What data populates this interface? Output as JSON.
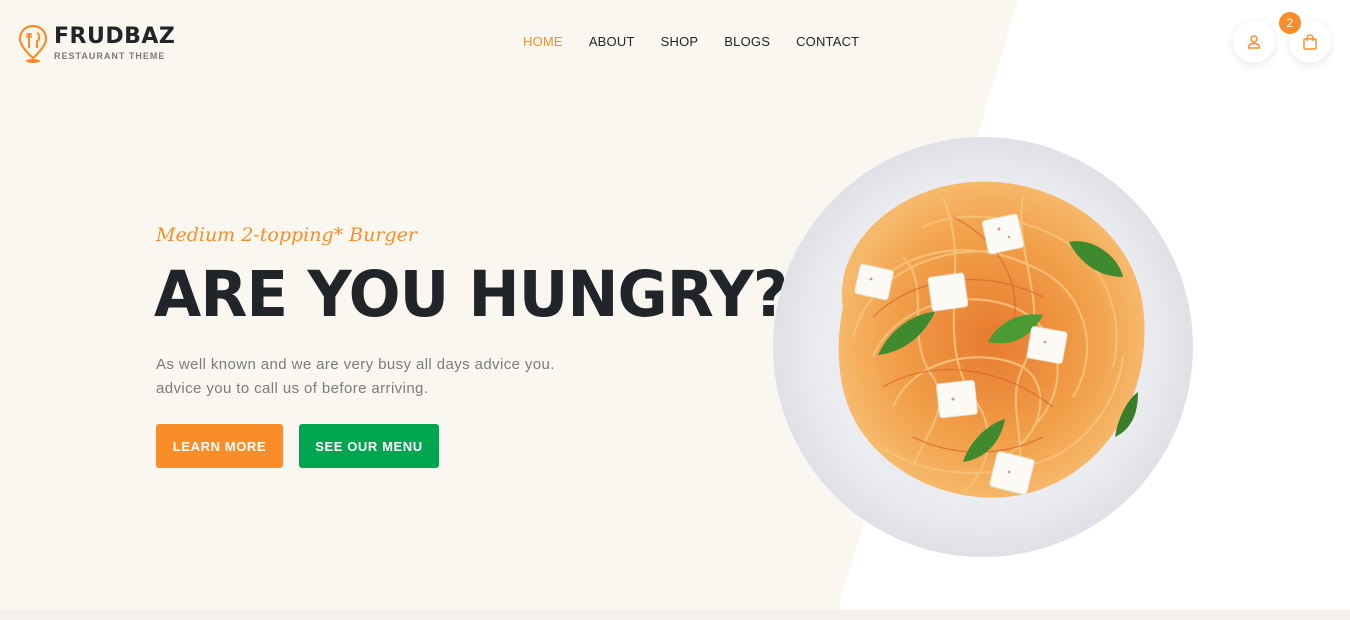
{
  "brand": {
    "name": "FRUDBAZ",
    "subtitle": "RESTAURANT THEME",
    "accent_color": "#fa8d27",
    "secondary_color": "#00a54f",
    "cream_background": "#faf7f1"
  },
  "nav": {
    "items": [
      {
        "label": "HOME",
        "active": true
      },
      {
        "label": "ABOUT",
        "active": false
      },
      {
        "label": "SHOP",
        "active": false
      },
      {
        "label": "BLOGS",
        "active": false
      },
      {
        "label": "CONTACT",
        "active": false
      }
    ]
  },
  "header_actions": {
    "user_icon": "user-icon",
    "cart_icon": "shopping-bag-icon",
    "cart_count": "2"
  },
  "hero": {
    "tagline": "Medium 2-topping* Burger",
    "headline": "ARE YOU HUNGRY?",
    "description_line1": "As well known and we are very busy all days advice you.",
    "description_line2": "advice you to call us of before arriving.",
    "primary_button": "LEARN MORE",
    "secondary_button": "SEE OUR MENU",
    "image": "plate-of-spaghetti-with-feta-and-basil"
  }
}
